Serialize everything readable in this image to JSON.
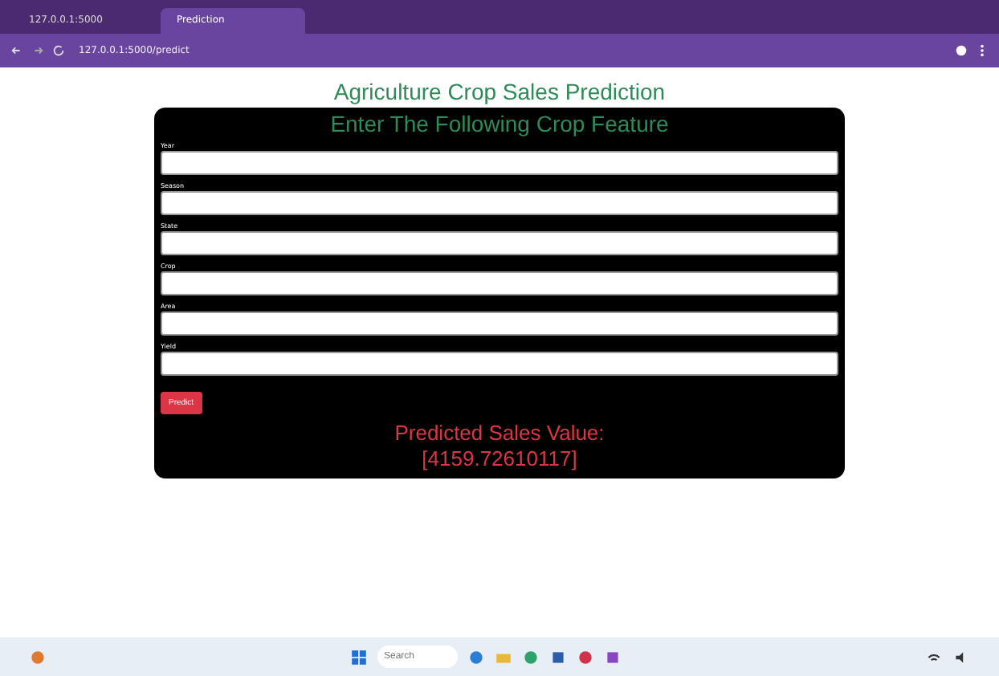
{
  "browser": {
    "tabs": [
      {
        "title": "127.0.0.1:5000",
        "selected": false
      },
      {
        "title": "Prediction",
        "selected": true
      }
    ],
    "address": "127.0.0.1:5000/predict"
  },
  "page": {
    "title": "Agriculture Crop Sales Prediction",
    "form_title": "Enter The Following Crop Feature",
    "fields": [
      {
        "label": "Year"
      },
      {
        "label": "Season"
      },
      {
        "label": "State"
      },
      {
        "label": "Crop"
      },
      {
        "label": "Area"
      },
      {
        "label": "Yield"
      }
    ],
    "button": "Predict",
    "result_label": "Predicted Sales Value:",
    "result_value": "[4159.72610117]"
  },
  "taskbar": {
    "search_placeholder": "Search"
  }
}
